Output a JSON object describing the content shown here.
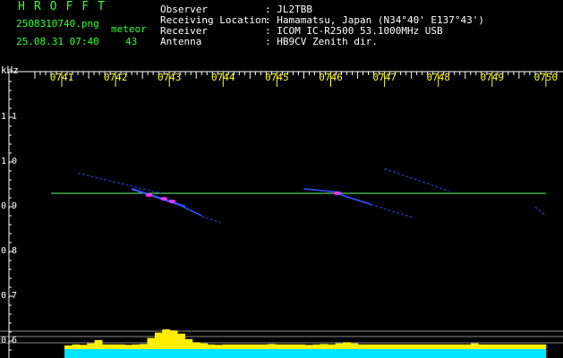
{
  "header": {
    "logo": "HROFFT",
    "filename": "2508310740.png",
    "meteor_label": "meteor",
    "datetime": "25.08.31 07:40",
    "meteor_count": "43",
    "station": {
      "observer_label": "Observer",
      "observer_value": ": JL2TBB",
      "location_label": "Receiving Location",
      "location_value": ": Hamamatsu, Japan (N34°40' E137°43')",
      "receiver_label": "Receiver",
      "receiver_value": ": ICOM IC-R2500 53.1000MHz USB",
      "antenna_label": "Antenna",
      "antenna_value": ": HB9CV Zenith dir."
    }
  },
  "colors": {
    "accent_green": "#33ff33",
    "tick_yellow": "#ffff33",
    "axis_white": "#ffffff",
    "reference_line": "#66ff66",
    "trail_blue": "#3355ff",
    "trail_hot": "#ff33ff",
    "level_cyan": "#00e5ff",
    "level_yellow": "#ffee00"
  },
  "chart_data": {
    "type": "heatmap",
    "ylabel": "kHz",
    "x_ticks": [
      "0741",
      "0742",
      "0743",
      "0744",
      "0745",
      "0746",
      "0747",
      "0748",
      "0749",
      "0750"
    ],
    "x_tick_minutes": [
      0,
      1,
      2,
      3,
      4,
      5,
      6,
      7,
      8,
      9
    ],
    "xlim_minutes": [
      -0.5,
      9.3
    ],
    "y_ticks": [
      "1.1",
      "1.0",
      "0.9",
      "0.8",
      "0.7",
      "0.6"
    ],
    "y_tick_values": [
      1.1,
      1.0,
      0.9,
      0.8,
      0.7,
      0.6
    ],
    "ylim_khz": [
      0.58,
      1.3
    ],
    "reference_line_khz": 0.93,
    "reference_line_span_minutes": [
      -0.2,
      9.0
    ],
    "meteor_trails": [
      {
        "t_start": 0.3,
        "f_start": 0.975,
        "t_end": 1.85,
        "f_end": 0.93,
        "intensity": "weak"
      },
      {
        "t_start": 1.3,
        "f_start": 0.94,
        "t_end": 2.3,
        "f_end": 0.9,
        "intensity": "strong"
      },
      {
        "t_start": 2.0,
        "f_start": 0.915,
        "t_end": 2.6,
        "f_end": 0.88,
        "intensity": "medium"
      },
      {
        "t_start": 2.6,
        "f_start": 0.878,
        "t_end": 2.95,
        "f_end": 0.865,
        "intensity": "weak"
      },
      {
        "t_start": 4.5,
        "f_start": 0.94,
        "t_end": 5.2,
        "f_end": 0.932,
        "intensity": "medium"
      },
      {
        "t_start": 5.1,
        "f_start": 0.93,
        "t_end": 5.75,
        "f_end": 0.905,
        "intensity": "medium"
      },
      {
        "t_start": 5.75,
        "f_start": 0.905,
        "t_end": 6.55,
        "f_end": 0.875,
        "intensity": "weak"
      },
      {
        "t_start": 6.0,
        "f_start": 0.985,
        "t_end": 7.2,
        "f_end": 0.935,
        "intensity": "weak"
      },
      {
        "t_start": 8.8,
        "f_start": 0.9,
        "t_end": 9.0,
        "f_end": 0.88,
        "intensity": "weak"
      }
    ],
    "meteor_heads": [
      {
        "t": 1.62,
        "f": 0.926
      },
      {
        "t": 1.9,
        "f": 0.918
      },
      {
        "t": 2.05,
        "f": 0.912
      },
      {
        "t": 5.12,
        "f": 0.93
      }
    ],
    "signal_level_profile": {
      "t_start": 0.05,
      "t_end": 9.0,
      "levels": [
        0.25,
        0.3,
        0.28,
        0.35,
        0.5,
        0.3,
        0.3,
        0.3,
        0.28,
        0.3,
        0.32,
        0.6,
        0.85,
        1.0,
        0.95,
        0.8,
        0.55,
        0.4,
        0.35,
        0.3,
        0.28,
        0.3,
        0.3,
        0.3,
        0.3,
        0.3,
        0.3,
        0.32,
        0.3,
        0.3,
        0.3,
        0.3,
        0.28,
        0.3,
        0.32,
        0.3,
        0.35,
        0.4,
        0.35,
        0.3,
        0.3,
        0.3,
        0.3,
        0.3,
        0.3,
        0.3,
        0.3,
        0.3,
        0.3,
        0.3,
        0.3,
        0.3,
        0.3,
        0.3,
        0.35,
        0.3,
        0.3,
        0.3,
        0.3,
        0.3,
        0.3,
        0.3,
        0.3,
        0.3
      ]
    }
  }
}
